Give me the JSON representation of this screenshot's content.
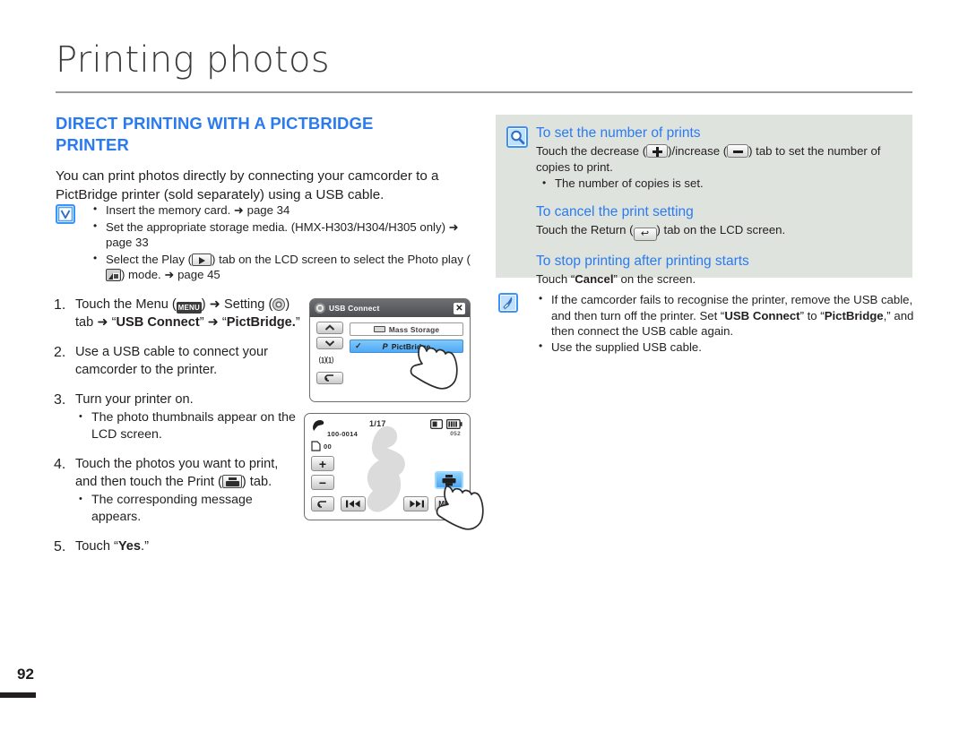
{
  "document": {
    "title": "Printing photos",
    "page_number": "92"
  },
  "section": {
    "heading": "DIRECT PRINTING WITH A PICTBRIDGE PRINTER",
    "intro": "You can print photos directly by connecting your camcorder to a PictBridge printer (sold separately) using a USB cable."
  },
  "prerequisites": {
    "icon": "check-mark-icon",
    "items": [
      {
        "text_before": "Insert the memory card. ",
        "ref": "➜ page 34",
        "text_after": ""
      },
      {
        "text_before": "Set the appropriate storage media. (HMX-H303/H304/H305 only) ",
        "ref": "➜ page 33",
        "text_after": ""
      },
      {
        "text_before": "Select the Play (",
        "icon1": "play-tab-icon",
        "mid": ") tab on the LCD screen to select the Photo play (",
        "icon2": "photo-play-icon",
        "text_after": ") mode. ",
        "ref": "➜ page 45"
      }
    ]
  },
  "steps": [
    {
      "num": "1.",
      "parts": {
        "a": "Touch the Menu (",
        "menu_icon_label": "MENU",
        "b": ") ➜ Setting (",
        "c": ") tab ➜ “",
        "bold1": "USB Connect",
        "d": "” ➜ “",
        "bold2": "PictBridge.",
        "e": "”"
      },
      "sub": []
    },
    {
      "num": "2.",
      "text": "Use a USB cable to connect your camcorder to the printer.",
      "sub": []
    },
    {
      "num": "3.",
      "text": "Turn your printer on.",
      "sub": [
        "The photo thumbnails appear on the LCD screen."
      ]
    },
    {
      "num": "4.",
      "parts": {
        "a": "Touch the photos you want to print, and then touch the Print (",
        "b": ") tab."
      },
      "sub": [
        "The corresponding message appears."
      ]
    },
    {
      "num": "5.",
      "parts": {
        "a": "Touch “",
        "bold": "Yes",
        "b": ".”"
      },
      "sub": []
    }
  ],
  "lcd_usb_connect": {
    "title": "USB Connect",
    "title_icon": "settings-gear-icon",
    "close_label": "✕",
    "up_arrow": "⌃",
    "down_arrow": "⌄",
    "volume_label": "⑴⑴",
    "return_label": "↩",
    "options": [
      {
        "label": "Mass Storage",
        "selected": false,
        "icon": "usb-storage-icon"
      },
      {
        "label": "PictBridge",
        "selected": true,
        "icon": "pictbridge-icon",
        "check": "✓"
      }
    ],
    "pointer": "hand-cursor-icon"
  },
  "lcd_photo_play": {
    "mode_icon": "pictbridge-icon",
    "file_number": "100-0014",
    "counter": "1/17",
    "card_icon": "storage-card-icon",
    "copies": "00",
    "remaining": "052",
    "battery_icon": "battery-icon",
    "power_icon": "dc-power-icon",
    "buttons": {
      "plus": "+",
      "minus": "−",
      "return": "↩",
      "prev": "⏮",
      "next": "⏭",
      "menu": "MENU",
      "print": "print-tab-icon"
    },
    "pointer": "hand-cursor-icon"
  },
  "tips_panel": {
    "icon": "magnifier-icon",
    "blocks": [
      {
        "heading": "To set the number of prints",
        "body_a": "Touch the decrease (",
        "body_b": ")/increase (",
        "body_c": ") tab to set the number of copies to print.",
        "bullets": [
          "The number of copies is set."
        ]
      },
      {
        "heading": "To cancel the print setting",
        "body_a": "Touch the Return (",
        "body_c": ") tab on the LCD screen.",
        "bullets": []
      },
      {
        "heading": "To stop printing after printing starts",
        "body_plain_a": "Touch “",
        "body_bold": "Cancel",
        "body_plain_b": "” on the screen.",
        "bullets": []
      }
    ]
  },
  "notes": {
    "icon": "pen-note-icon",
    "items": [
      {
        "a": "If the camcorder fails to recognise the printer, remove the USB cable, and then turn off the printer. Set “",
        "bold1": "USB Connect",
        "b": "” to “",
        "bold2": "PictBridge",
        "c": ",” and then connect the USB cable again."
      },
      {
        "plain": "Use the supplied USB cable."
      }
    ]
  },
  "colors": {
    "accent_blue": "#2a7bf0",
    "icon_blue": "#3d94f5",
    "panel_grey": "#dfe3de",
    "rule_grey": "#9a9a9a",
    "text": "#231f20"
  }
}
